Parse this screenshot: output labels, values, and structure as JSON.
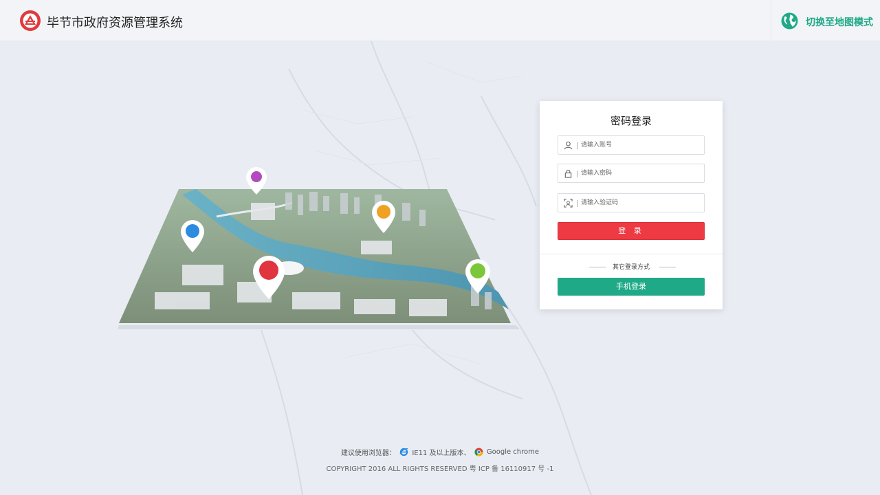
{
  "header": {
    "title": "毕节市政府资源管理系统",
    "mode_switch_label": "切换至地图模式"
  },
  "login": {
    "title": "密码登录",
    "account_placeholder": "请输入账号",
    "password_placeholder": "请输入密码",
    "captcha_placeholder": "请输入验证码",
    "login_label": "登 录",
    "other_methods_label": "其它登录方式",
    "phone_login_label": "手机登录"
  },
  "footer": {
    "browser_prefix": "建议使用浏览器：",
    "browser_ie": "IE11 及以上版本、",
    "browser_chrome": "Google chrome",
    "copyright": "COPYRIGHT 2016 ALL RIGHTS RESERVED 粤 ICP 备 16110917 号 -1"
  },
  "icons": {
    "logo": "government-emblem-icon",
    "globe": "globe-icon",
    "user": "user-icon",
    "lock": "lock-icon",
    "captcha": "captcha-icon",
    "ie": "ie-browser-icon",
    "chrome": "chrome-browser-icon"
  },
  "colors": {
    "brand_green": "#1fa987",
    "login_red": "#ee3a43",
    "logo_red": "#e03a3e",
    "background": "#e9edf3"
  }
}
